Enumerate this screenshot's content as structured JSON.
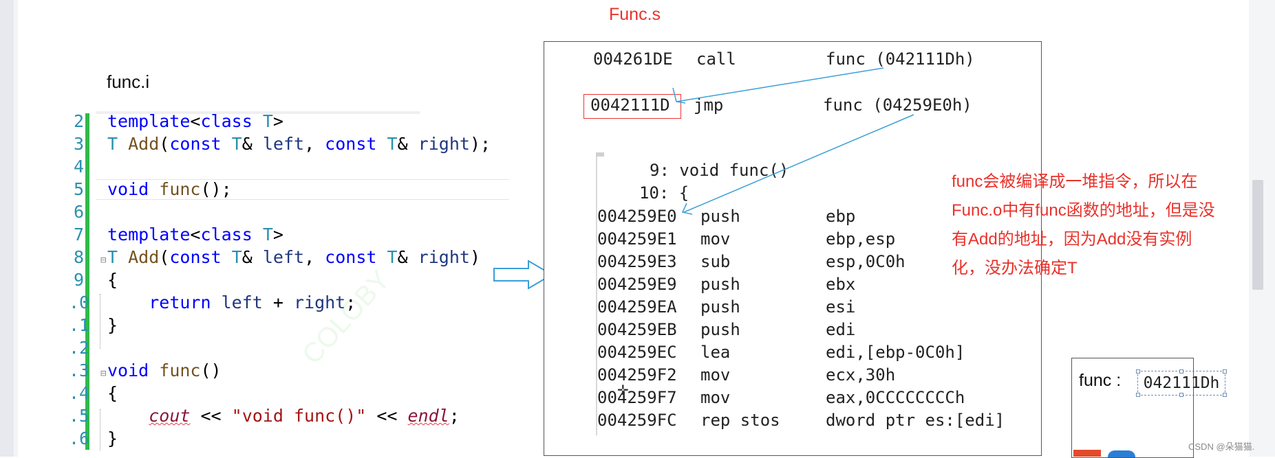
{
  "titles": {
    "func_s": "Func.s",
    "func_i": "func.i"
  },
  "code_lines": [
    {
      "n": "2",
      "fold": "",
      "html": "<span class=\"kw\">template</span>&lt;<span class=\"kw\">class</span> <span class=\"tp\">T</span>&gt;"
    },
    {
      "n": "3",
      "fold": "",
      "html": "<span class=\"tp\">T</span> <span class=\"fn\">Add</span>(<span class=\"kw\">const</span> <span class=\"tp\">T</span>&amp; <span class=\"pm\">left</span>, <span class=\"kw\">const</span> <span class=\"tp\">T</span>&amp; <span class=\"pm\">right</span>);"
    },
    {
      "n": "4",
      "fold": "",
      "html": ""
    },
    {
      "n": "5",
      "fold": "",
      "html": "<span class=\"kw\">void</span> <span class=\"fn\">func</span>();"
    },
    {
      "n": "6",
      "fold": "",
      "html": ""
    },
    {
      "n": "7",
      "fold": "",
      "html": "<span class=\"kw\">template</span>&lt;<span class=\"kw\">class</span> <span class=\"tp\">T</span>&gt;"
    },
    {
      "n": "8",
      "fold": "⊟",
      "html": "<span class=\"tp\">T</span> <span class=\"fn\">Add</span>(<span class=\"kw\">const</span> <span class=\"tp\">T</span>&amp; <span class=\"pm\">left</span>, <span class=\"kw\">const</span> <span class=\"tp\">T</span>&amp; <span class=\"pm\">right</span>)"
    },
    {
      "n": "9",
      "fold": "",
      "html": "{"
    },
    {
      "n": ".0",
      "fold": "",
      "html": "    <span class=\"kw\">return</span> <span class=\"pm\">left</span> + <span class=\"pm\">right</span>;"
    },
    {
      "n": ".1",
      "fold": "",
      "html": "}"
    },
    {
      "n": ".2",
      "fold": "",
      "html": ""
    },
    {
      "n": ".3",
      "fold": "⊟",
      "html": "<span class=\"kw\">void</span> <span class=\"fn\">func</span>()"
    },
    {
      "n": ".4",
      "fold": "",
      "html": "{"
    },
    {
      "n": ".5",
      "fold": "",
      "html": "    <span class=\"it\">cout</span> &lt;&lt; <span class=\"st\">\"void func()\"</span> &lt;&lt; <span class=\"it\">endl</span>;"
    },
    {
      "n": ".6",
      "fold": "",
      "html": "}"
    }
  ],
  "asm_top": [
    {
      "addr": "004261DE",
      "op": "call",
      "arg": "func (042111Dh)"
    },
    {
      "addr": "0042111D",
      "op": "jmp",
      "arg": "func (04259E0h)"
    }
  ],
  "asm_labels": [
    "9: void func()",
    "10: {"
  ],
  "asm_body": [
    {
      "addr": "004259E0",
      "op": "push",
      "arg": "ebp"
    },
    {
      "addr": "004259E1",
      "op": "mov",
      "arg": "ebp,esp"
    },
    {
      "addr": "004259E3",
      "op": "sub",
      "arg": "esp,0C0h"
    },
    {
      "addr": "004259E9",
      "op": "push",
      "arg": "ebx"
    },
    {
      "addr": "004259EA",
      "op": "push",
      "arg": "esi"
    },
    {
      "addr": "004259EB",
      "op": "push",
      "arg": "edi"
    },
    {
      "addr": "004259EC",
      "op": "lea",
      "arg": "edi,[ebp-0C0h]"
    },
    {
      "addr": "004259F2",
      "op": "mov",
      "arg": "ecx,30h"
    },
    {
      "addr": "004259F7",
      "op": "mov",
      "arg": "eax,0CCCCCCCCh"
    },
    {
      "addr": "004259FC",
      "op": "rep stos",
      "arg": "dword ptr es:[edi]"
    }
  ],
  "note": {
    "lines": [
      "func会被编译成一堆指令，所以在",
      "Func.o中有func函数的地址，但是没",
      "有Add的地址，因为Add没有实例",
      "化，没办法确定T"
    ]
  },
  "func_box": {
    "label": "func :",
    "value": "042111Dh"
  },
  "credit": "CSDN @朵猫猫.",
  "colors": {
    "accent_red": "#e8322b",
    "line_blue": "#3a9fd8",
    "gutter_green": "#2fb94a"
  },
  "icons": {
    "arrow": "hollow-right-arrow-icon",
    "cursor": "crosshair-cursor-icon"
  }
}
